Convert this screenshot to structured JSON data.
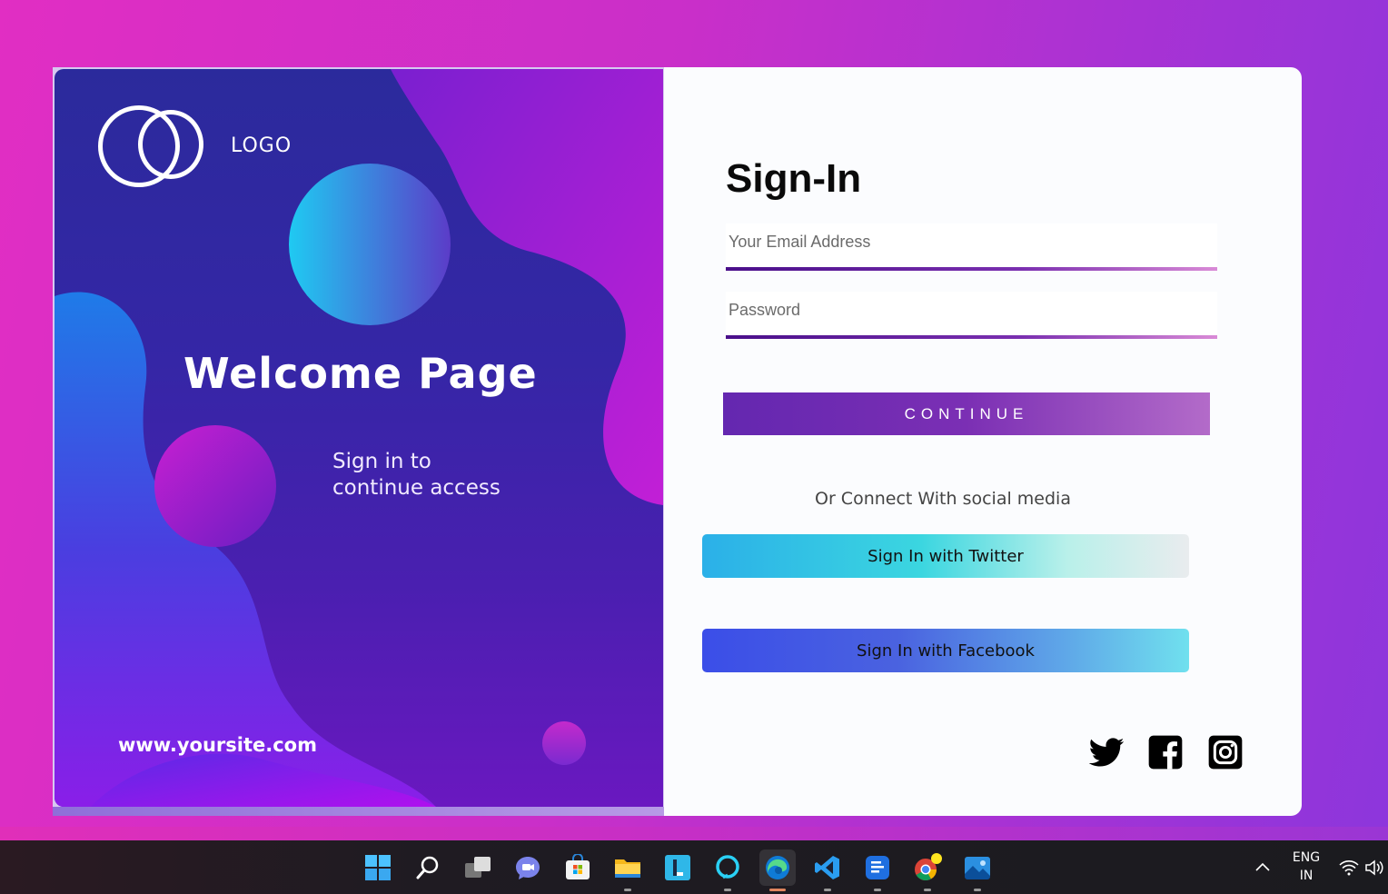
{
  "welcome": {
    "logo_text": "LOGO",
    "title": "Welcome Page",
    "subtitle_line1": "Sign in to",
    "subtitle_line2": "continue access",
    "website": "www.yoursite.com"
  },
  "signin": {
    "title": "Sign-In",
    "email_placeholder": "Your Email Address",
    "email_value": "",
    "password_placeholder": "Password",
    "password_value": "",
    "continue_label": "CONTINUE",
    "social_text": "Or Connect With social media",
    "twitter_label": "Sign In with Twitter",
    "facebook_label": "Sign In with Facebook",
    "social_icons": [
      "twitter-icon",
      "facebook-icon",
      "instagram-icon"
    ]
  },
  "taskbar": {
    "apps": [
      "start-icon",
      "search-icon",
      "task-view-icon",
      "teams-chat-icon",
      "microsoft-store-icon",
      "file-explorer-icon",
      "l-app-icon",
      "cortana-icon",
      "edge-icon",
      "vscode-icon",
      "docs-app-icon",
      "chrome-icon",
      "photos-icon"
    ],
    "active_app": "edge-icon",
    "language_line1": "ENG",
    "language_line2": "IN"
  },
  "colors": {
    "background_gradient": [
      "#e12ec3",
      "#8c36dc"
    ],
    "continue_gradient": [
      "#6427b0",
      "#b36bc9"
    ],
    "twitter_gradient": [
      "#2bb0e8",
      "#e9ecee"
    ],
    "facebook_gradient": [
      "#3b4ee8",
      "#70e0ee"
    ]
  }
}
